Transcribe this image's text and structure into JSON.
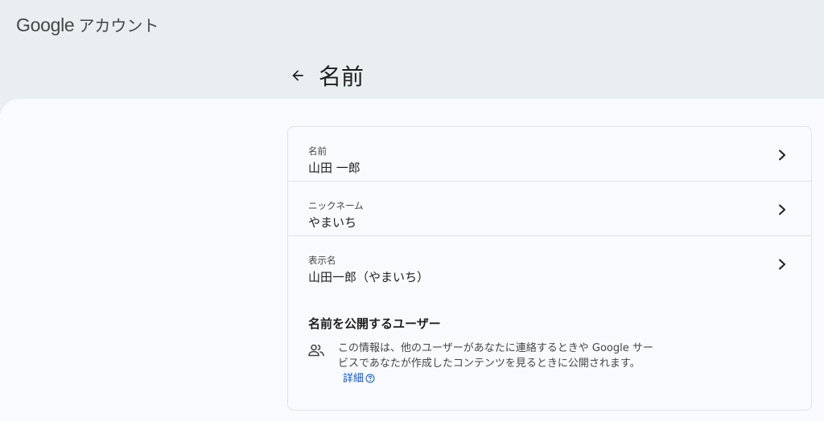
{
  "brand": {
    "google": "Google",
    "product": "アカウント"
  },
  "page": {
    "title": "名前"
  },
  "rows": [
    {
      "label": "名前",
      "value": "山田 一郎"
    },
    {
      "label": "ニックネーム",
      "value": "やまいち"
    },
    {
      "label": "表示名",
      "value": "山田一郎（やまいち）"
    }
  ],
  "visibility": {
    "title": "名前を公開するユーザー",
    "description": "この情報は、他のユーザーがあなたに連絡するときや Google サービスであなたが作成したコンテンツを見るときに公開されます。",
    "link_label": "詳細"
  },
  "colors": {
    "page_background": "#e9eef1",
    "surface": "#f8fafd",
    "text_primary": "#1f1f1f",
    "text_secondary": "#444746",
    "link": "#0b57d0",
    "divider": "#e0e3e7"
  },
  "icons": {
    "back": "arrow-back-icon",
    "chevron": "chevron-right-icon",
    "people": "people-icon",
    "help": "help-circle-icon"
  }
}
